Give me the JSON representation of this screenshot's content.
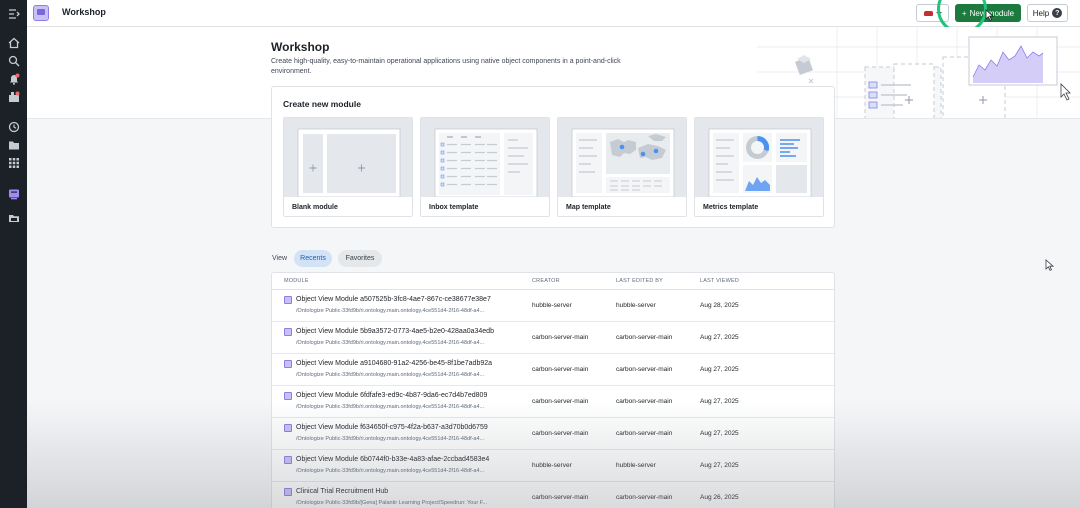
{
  "rail": {
    "icons": [
      "menu-expand-icon",
      "home-icon",
      "search-icon",
      "notifications-icon",
      "applications-icon",
      "recent-icon",
      "files-icon",
      "apps-grid-icon",
      "workshop-icon",
      "folder-icon"
    ]
  },
  "topbar": {
    "app_title": "Workshop",
    "new_module_label": "New module",
    "help_label": "Help"
  },
  "hero": {
    "title": "Workshop",
    "description": "Create high-quality, easy-to-maintain operational applications using native object components in a point-and-click environment."
  },
  "create": {
    "title": "Create new module",
    "templates": [
      {
        "label": "Blank module"
      },
      {
        "label": "Inbox template"
      },
      {
        "label": "Map template"
      },
      {
        "label": "Metrics template"
      }
    ]
  },
  "view": {
    "label": "View",
    "tabs": [
      "Recents",
      "Favorites"
    ],
    "selected": "Recents"
  },
  "table": {
    "headers": {
      "module": "MODULE",
      "creator": "CREATOR",
      "last_edited_by": "LAST EDITED BY",
      "last_viewed": "LAST VIEWED"
    },
    "rows": [
      {
        "name": "Object View Module a507525b-3fc8-4ae7-867c-ce38677e38e7",
        "path": "/Ontologize Public-33fd9b/ri.ontology.main.ontology.4ce551d4-2f16-48df-a4...",
        "creator": "hubble-server",
        "edited_by": "hubble-server",
        "viewed": "Aug 28, 2025"
      },
      {
        "name": "Object View Module 5b9a3572-0773-4ae5-b2e0-428aa0a34edb",
        "path": "/Ontologize Public-33fd9b/ri.ontology.main.ontology.4ce551d4-2f16-48df-a4...",
        "creator": "carbon-server-main",
        "edited_by": "carbon-server-main",
        "viewed": "Aug 27, 2025"
      },
      {
        "name": "Object View Module a9104680-91a2-4256-be45-8f1be7adb92a",
        "path": "/Ontologize Public-33fd9b/ri.ontology.main.ontology.4ce551d4-2f16-48df-a4...",
        "creator": "carbon-server-main",
        "edited_by": "carbon-server-main",
        "viewed": "Aug 27, 2025"
      },
      {
        "name": "Object View Module 6fdfafe3-ed9c-4b87-9da6-ec7d4b7ed809",
        "path": "/Ontologize Public-33fd9b/ri.ontology.main.ontology.4ce551d4-2f16-48df-a4...",
        "creator": "carbon-server-main",
        "edited_by": "carbon-server-main",
        "viewed": "Aug 27, 2025"
      },
      {
        "name": "Object View Module f634650f-c975-4f2a-b637-a3d70b0d6759",
        "path": "/Ontologize Public-33fd9b/ri.ontology.main.ontology.4ce551d4-2f16-48df-a4...",
        "creator": "carbon-server-main",
        "edited_by": "carbon-server-main",
        "viewed": "Aug 27, 2025"
      },
      {
        "name": "Object View Module 6b0744f0-b33e-4a83-afae-2ccbad4583e4",
        "path": "/Ontologize Public-33fd9b/ri.ontology.main.ontology.4ce551d4-2f16-48df-a4...",
        "creator": "hubble-server",
        "edited_by": "hubble-server",
        "viewed": "Aug 27, 2025"
      },
      {
        "name": "Clinical Trial Recruitment Hub",
        "path": "/Ontologize Public-33fd9b/[Gena] Palantir Learning Project/Speedrun: Your F...",
        "creator": "carbon-server-main",
        "edited_by": "carbon-server-main",
        "viewed": "Aug 26, 2025"
      }
    ]
  },
  "colors": {
    "rail_bg": "#1c2127",
    "primary_green": "#1d7a3e",
    "highlight_ring": "#23c47a",
    "workshop_purple": "#8f7de6",
    "recents_tab_bg": "#d3e3f7",
    "recents_tab_text": "#215db0"
  }
}
